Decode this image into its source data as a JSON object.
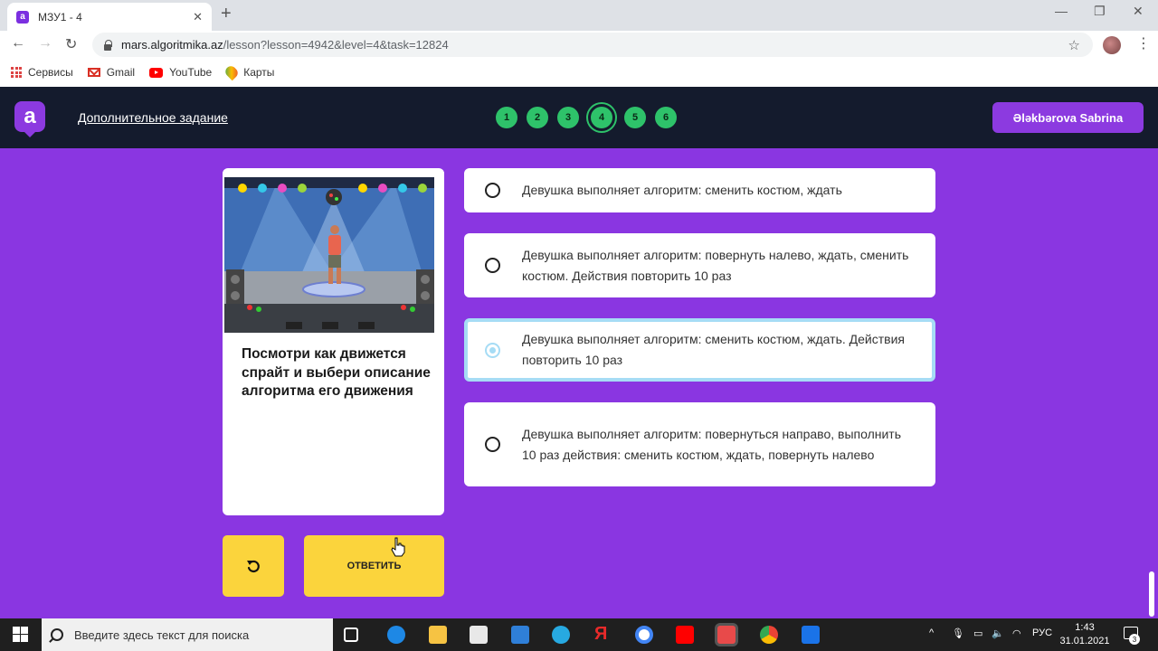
{
  "browser": {
    "tab_title": "МЗУ1 - 4",
    "tab_favicon": "a",
    "new_tab": "+",
    "url_host": "mars.algoritmika.az",
    "url_path": "/lesson?lesson=4942&level=4&task=12824",
    "bookmarks": [
      {
        "label": "Сервисы",
        "icon": "apps-grid-icon"
      },
      {
        "label": "Gmail",
        "icon": "gmail-icon"
      },
      {
        "label": "YouTube",
        "icon": "youtube-icon"
      },
      {
        "label": "Карты",
        "icon": "maps-icon"
      }
    ]
  },
  "header": {
    "logo": "a",
    "link": "Дополнительное задание",
    "steps": [
      "1",
      "2",
      "3",
      "4",
      "5",
      "6"
    ],
    "active_step": "4",
    "user": "Ələkbərova Sabrina"
  },
  "task": {
    "question": "Посмотри как движется спрайт и выбери описание алгоритма его движения",
    "options": [
      {
        "text": "Девушка выполняет алгоритм:  сменить костюм, ждать",
        "selected": false
      },
      {
        "text": "Девушка выполняет алгоритм: повернуть налево, ждать, сменить костюм. Действия повторить 10 раз",
        "selected": false
      },
      {
        "text": "Девушка выполняет алгоритм: сменить костюм, ждать. Действия повторить 10 раз",
        "selected": true
      },
      {
        "text": "Девушка выполняет алгоритм: повернуться направо, выполнить 10 раз действия: сменить костюм, ждать, повернуть налево",
        "selected": false
      }
    ],
    "answer_button": "ОТВЕТИТЬ"
  },
  "taskbar": {
    "search_placeholder": "Введите здесь текст для поиска",
    "language": "РУС",
    "time": "1:43",
    "date": "31.01.2021",
    "notifications": "3"
  },
  "colors": {
    "main_bg": "#8a36e1",
    "header_bg": "#141b2d",
    "step_green": "#2ec26a",
    "button_yellow": "#fbd43c",
    "selected_border": "#a6dcf5"
  }
}
